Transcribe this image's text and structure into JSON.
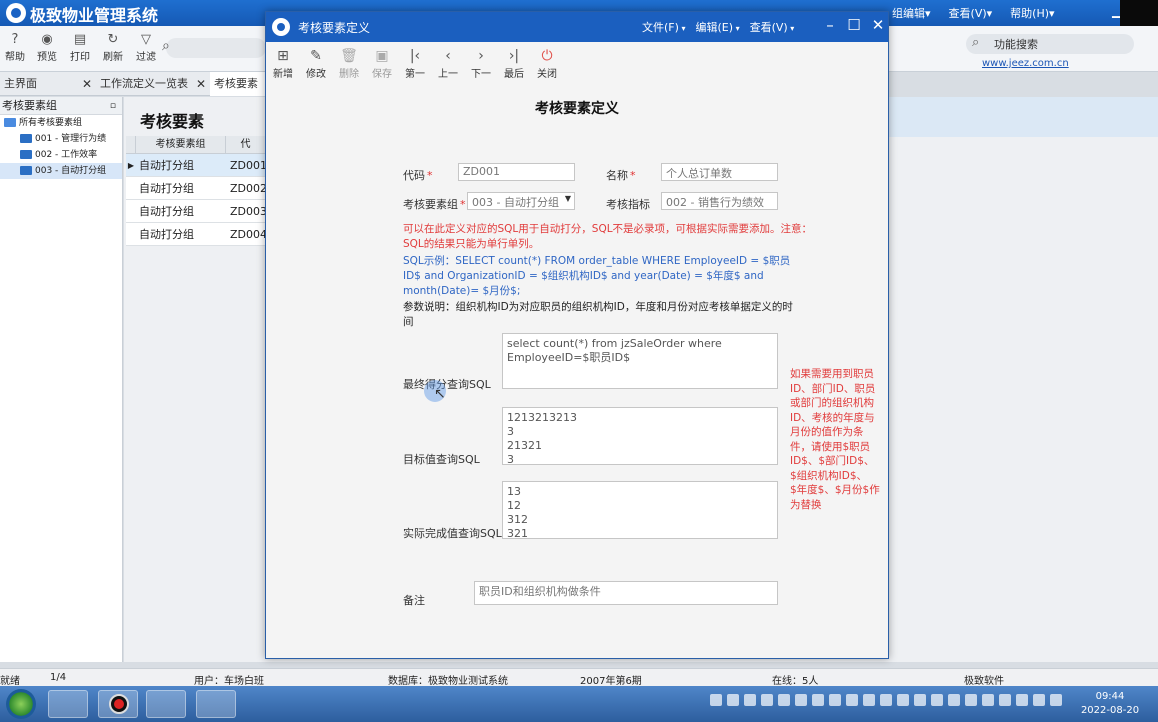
{
  "app": {
    "title": "极致物业管理系统",
    "menu": [
      "组编辑▾",
      "查看(V)▾",
      "帮助(H)▾"
    ],
    "toolbar": [
      "帮助",
      "预览",
      "打印",
      "刷新",
      "过滤"
    ],
    "func_search": "功能搜索",
    "site_link": "www.jeez.com.cn",
    "tabs": [
      "主界面",
      "工作流定义一览表",
      "考核要素"
    ],
    "left_panel": {
      "header": "考核要素组",
      "tree": [
        "所有考核要素组",
        "001 - 管理行为绩",
        "002 - 工作效率",
        "003 - 自动打分组"
      ]
    },
    "content_title": "考核要素",
    "grid": {
      "headers": [
        "考核要素组",
        "代"
      ],
      "rows": [
        [
          "自动打分组",
          "ZD001"
        ],
        [
          "自动打分组",
          "ZD002"
        ],
        [
          "自动打分组",
          "ZD003"
        ],
        [
          "自动打分组",
          "ZD004"
        ]
      ]
    },
    "status": {
      "ready": "就绪",
      "page": "1/4",
      "user": "用户：车场白班",
      "db": "数据库：极致物业测试系统",
      "period": "2007年第6期",
      "online": "在线：5人",
      "brand": "极致软件"
    },
    "clock": {
      "time": "09:44",
      "date": "2022-08-20"
    }
  },
  "dialog": {
    "title": "考核要素定义",
    "menu": [
      "文件(F)",
      "编辑(E)",
      "查看(V)"
    ],
    "toolbar": [
      {
        "label": "新增",
        "icon": "new-icon"
      },
      {
        "label": "修改",
        "icon": "edit-icon"
      },
      {
        "label": "删除",
        "icon": "delete-icon"
      },
      {
        "label": "保存",
        "icon": "save-icon"
      },
      {
        "label": "第一",
        "icon": "first-icon"
      },
      {
        "label": "上一",
        "icon": "prev-icon"
      },
      {
        "label": "下一",
        "icon": "next-icon"
      },
      {
        "label": "最后",
        "icon": "last-icon"
      },
      {
        "label": "关闭",
        "icon": "power-icon"
      }
    ],
    "form_title": "考核要素定义",
    "fields": {
      "code_label": "代码",
      "code_value": "ZD001",
      "name_label": "名称",
      "name_value": "个人总订单数",
      "group_label": "考核要素组",
      "group_value": "003 - 自动打分组",
      "indicator_label": "考核指标",
      "indicator_value": "002 - 销售行为绩效"
    },
    "note_red": "可以在此定义对应的SQL用于自动打分，SQL不是必录项，可根据实际需要添加。注意：SQL的结果只能为单行单列。",
    "note_blue": "SQL示例：SELECT count(*) FROM order_table WHERE EmployeeID = $职员ID$ and OrganizationID = $组织机构ID$ and year(Date) = $年度$ and month(Date)= $月份$;",
    "note_black": "参数说明：组织机构ID为对应职员的组织机构ID，年度和月份对应考核单据定义的时间",
    "sql_final_label": "最终得分查询SQL",
    "sql_final_value": "select count(*) from jzSaleOrder where EmployeeID=$职员ID$",
    "sql_target_label": "目标值查询SQL",
    "sql_target_lines": [
      "1213213213",
      "3",
      "21321",
      "3"
    ],
    "sql_actual_label": "实际完成值查询SQL",
    "sql_actual_lines": [
      "13",
      "12",
      "312",
      "321"
    ],
    "side_note": "如果需要用到职员ID、部门ID、职员或部门的组织机构ID、考核的年度与月份的值作为条件，请使用$职员ID$、$部门ID$、$组织机构ID$、$年度$、$月份$作为替换",
    "remark_label": "备注",
    "remark_placeholder": "职员ID和组织机构做条件"
  }
}
